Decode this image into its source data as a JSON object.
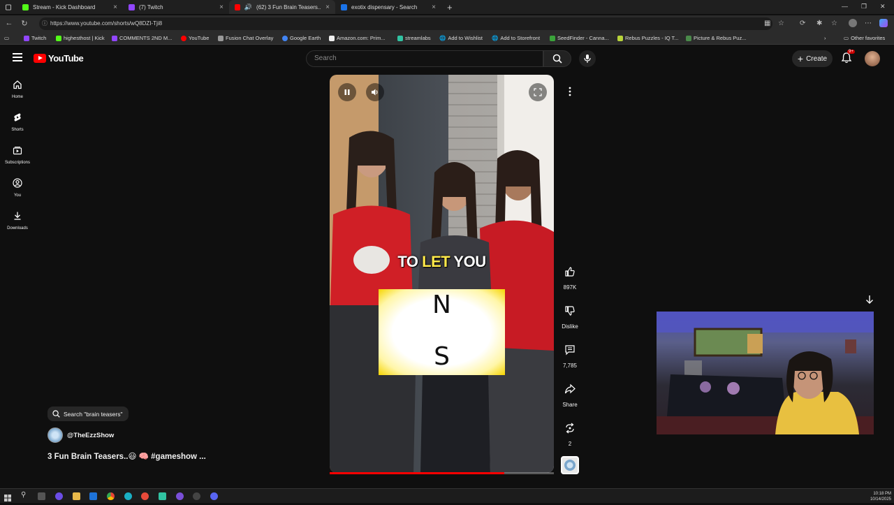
{
  "browser": {
    "tabs": [
      {
        "title": "Stream - Kick Dashboard",
        "color": "#53fc18"
      },
      {
        "title": "(7) Twitch",
        "color": "#9146ff"
      },
      {
        "title": "(62) 3 Fun Brain Teasers..😃 #",
        "color": "#ff0000"
      },
      {
        "title": "exotix dispensary - Search",
        "color": "#1a73e8"
      }
    ],
    "url": "https://www.youtube.com/shorts/wQ8DZI-Tji8",
    "bookmarks": [
      "Twitch",
      "highesthost | Kick",
      "COMMENTS 2ND M...",
      "YouTube",
      "Fusion Chat Overlay",
      "Google Earth",
      "Amazon.com: Prim...",
      "streamlabs",
      "Add to Wishlist",
      "Add to Storefront",
      "SeedFinder - Canna...",
      "Rebus Puzzles - IQ T...",
      "Picture & Rebus Puz..."
    ],
    "other_favorites": "Other favorites"
  },
  "youtube": {
    "logo_text": "YouTube",
    "search_placeholder": "Search",
    "create_label": "Create",
    "notif_badge": "9+",
    "sidebar": [
      {
        "label": "Home",
        "icon": "home-icon"
      },
      {
        "label": "Shorts",
        "icon": "shorts-icon"
      },
      {
        "label": "Subscriptions",
        "icon": "subscriptions-icon"
      },
      {
        "label": "You",
        "icon": "you-icon"
      },
      {
        "label": "Downloads",
        "icon": "download-icon"
      }
    ],
    "video": {
      "caption_pre": "TO ",
      "caption_hl": "LET",
      "caption_post": " YOU",
      "letter_top": "N",
      "letter_bottom": "S",
      "progress_fraction": 0.78
    },
    "actions": {
      "likes": "897K",
      "dislike_label": "Dislike",
      "comments": "7,785",
      "share_label": "Share",
      "remix_count": "2"
    },
    "search_chip": "Search \"brain teasers\"",
    "channel": "@TheEzzShow",
    "title": "3 Fun Brain Teasers..😃 🧠 #gameshow ..."
  },
  "taskbar": {
    "time": "10:18 PM",
    "date": "10/14/2025"
  }
}
